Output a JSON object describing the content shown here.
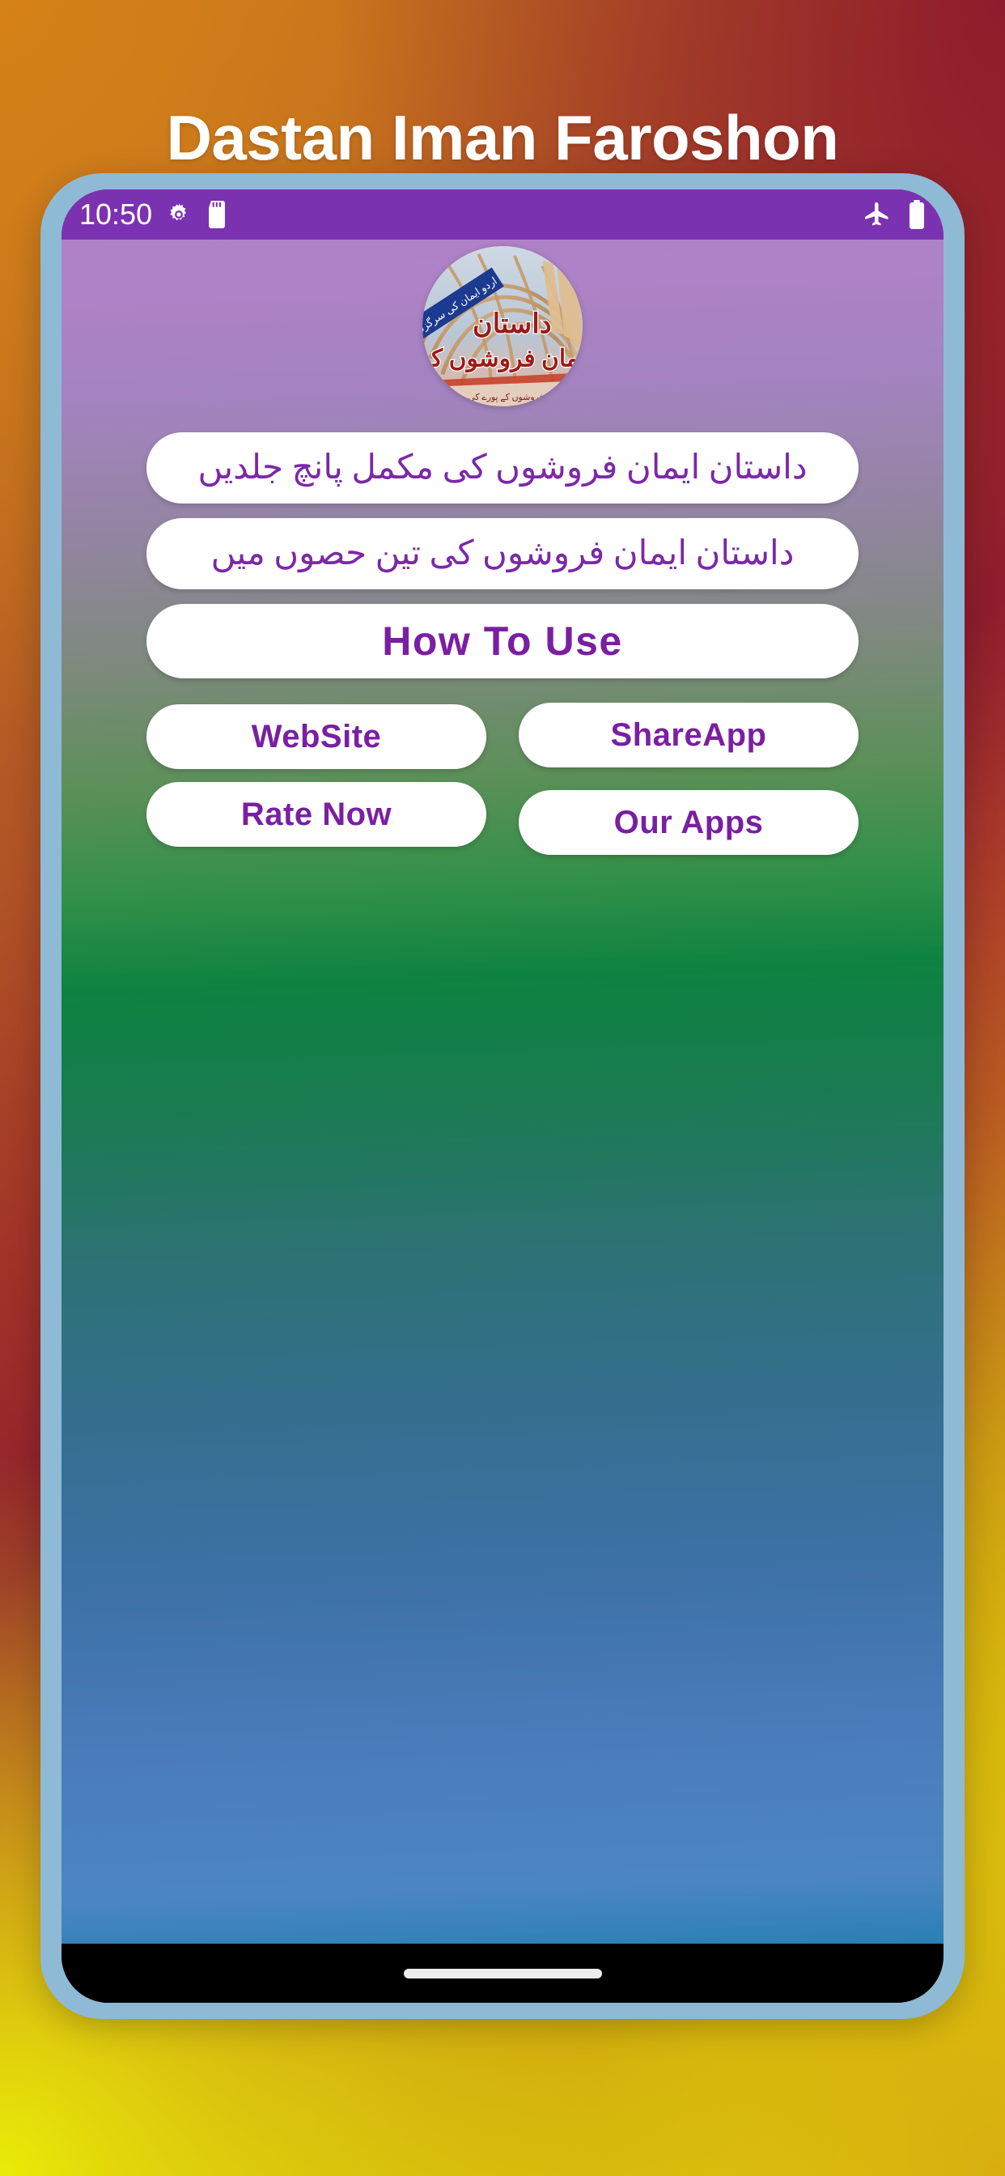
{
  "header": {
    "title": "Dastan Iman Faroshon",
    "title_color": "#ffffff"
  },
  "theme": {
    "status_bar_color": "#7B32B0",
    "button_bg": "#ffffff",
    "button_text_color": "#7A1FA2",
    "phone_bezel_color": "#8FBAD6",
    "nav_bar_color": "#000000"
  },
  "status_bar": {
    "time": "10:50",
    "left_icons": [
      "settings-gear-icon",
      "sd-card-icon"
    ],
    "right_icons": [
      "airplane-mode-icon",
      "battery-icon"
    ]
  },
  "app": {
    "logo_name": "dastan-iman-faroshon-logo",
    "logo_title_line1": "داستان",
    "logo_title_line2": "ایمان فروشوں کی",
    "logo_banner_text": "اردو اور ایمان کی سرگزشت"
  },
  "main": {
    "buttons": [
      {
        "id": "five-volumes",
        "label": "داستان ایمان فروشوں کی مکمل پانچ جلدیں",
        "style": "wide-urdu"
      },
      {
        "id": "three-parts",
        "label": "داستان ایمان فروشوں کی تین حصوں میں",
        "style": "wide-urdu"
      },
      {
        "id": "how-to-use",
        "label": "How To Use",
        "style": "wide-latin"
      }
    ],
    "row1": [
      {
        "id": "website",
        "label": "WebSite"
      },
      {
        "id": "shareapp",
        "label": "ShareApp"
      }
    ],
    "row2": [
      {
        "id": "rate-now",
        "label": "Rate Now"
      },
      {
        "id": "our-apps",
        "label": "Our Apps"
      }
    ]
  },
  "nav": {
    "home_indicator": "home-indicator"
  }
}
